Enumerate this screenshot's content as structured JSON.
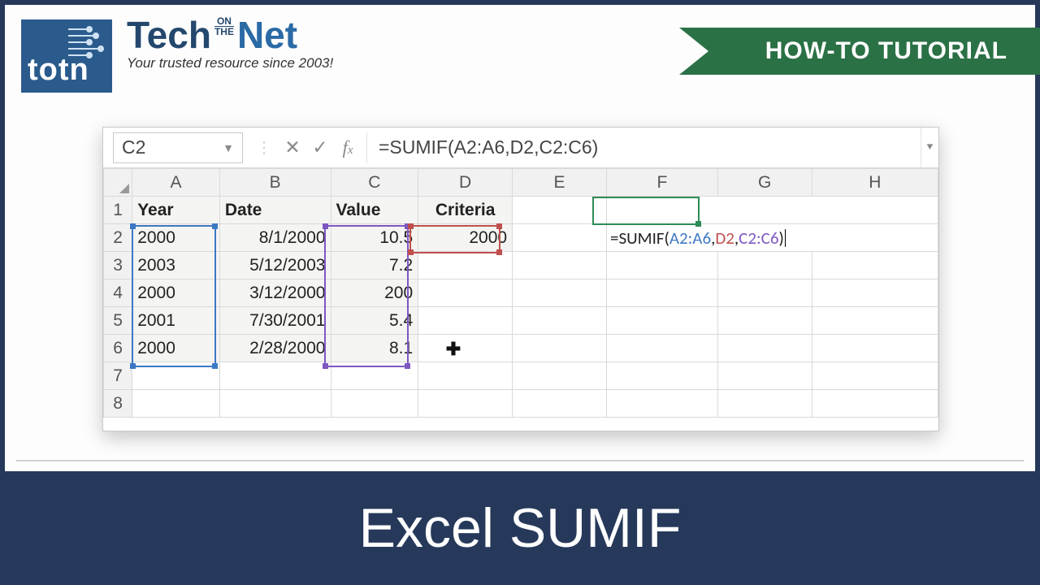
{
  "brand": {
    "logo_text": "totn",
    "name_pre": "Tech",
    "name_on": "ON",
    "name_the": "THE",
    "name_post": "Net",
    "tagline": "Your trusted resource since 2003!"
  },
  "ribbon": {
    "label": "HOW-TO TUTORIAL"
  },
  "excel": {
    "name_box": "C2",
    "formula_bar": "=SUMIF(A2:A6,D2,C2:C6)",
    "columns": [
      "A",
      "B",
      "C",
      "D",
      "E",
      "F",
      "G",
      "H"
    ],
    "row_numbers": [
      "1",
      "2",
      "3",
      "4",
      "5",
      "6",
      "7",
      "8"
    ],
    "headers": {
      "A1": "Year",
      "B1": "Date",
      "C1": "Value",
      "D1": "Criteria"
    },
    "data": {
      "A": [
        "2000",
        "2003",
        "2000",
        "2001",
        "2000"
      ],
      "B": [
        "8/1/2000",
        "5/12/2003",
        "3/12/2000",
        "7/30/2001",
        "2/28/2000"
      ],
      "C": [
        "10.5",
        "7.2",
        "200",
        "5.4",
        "8.1"
      ],
      "D2": "2000"
    },
    "inline_formula": {
      "prefix": "=SUMIF(",
      "arg1": "A2:A6",
      "sep1": ",",
      "arg2": "D2",
      "sep2": ",",
      "arg3": "C2:C6",
      "suffix": ")"
    }
  },
  "footer": {
    "title": "Excel SUMIF"
  }
}
